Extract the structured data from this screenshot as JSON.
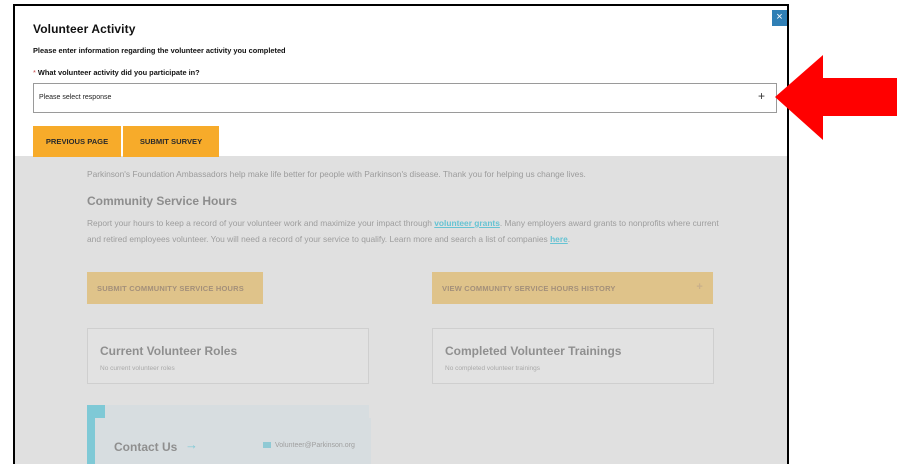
{
  "modal": {
    "title": "Volunteer Activity",
    "subtitle": "Please enter information regarding the volunteer activity you completed",
    "question_required_marker": "*",
    "question": "What volunteer activity did you participate in?",
    "select_value": "Please select response",
    "select_plus": "+",
    "previous_label": "PREVIOUS PAGE",
    "submit_label": "SUBMIT SURVEY",
    "close_glyph": "×"
  },
  "background": {
    "intro": "Parkinson's Foundation Ambassadors help make life better for people with Parkinson's disease. Thank you for helping us change lives.",
    "section_title": "Community Service Hours",
    "text_1": "Report your hours to keep a record of your volunteer work and maximize your impact through ",
    "link_grants": "volunteer grants",
    "text_2": ". Many employers award grants to nonprofits where current and retired employees volunteer. You will need a record of your service to qualify. Learn more and search a list of companies ",
    "link_here": "here",
    "text_3": ".",
    "submit_hours_label": "SUBMIT COMMUNITY SERVICE HOURS",
    "view_history_label": "VIEW COMMUNITY SERVICE HOURS HISTORY",
    "view_history_plus": "+",
    "current_roles_title": "Current Volunteer Roles",
    "current_roles_sub": "No current volunteer roles",
    "completed_trainings_title": "Completed Volunteer Trainings",
    "completed_trainings_sub": "No completed volunteer trainings",
    "contact_title": "Contact Us",
    "contact_arrow": "→",
    "contact_email": "Volunteer@Parkinson.org"
  },
  "colors": {
    "accent_orange": "#f7ab2a",
    "close_blue": "#2f7fb5",
    "annotation_red": "#ff0000"
  }
}
